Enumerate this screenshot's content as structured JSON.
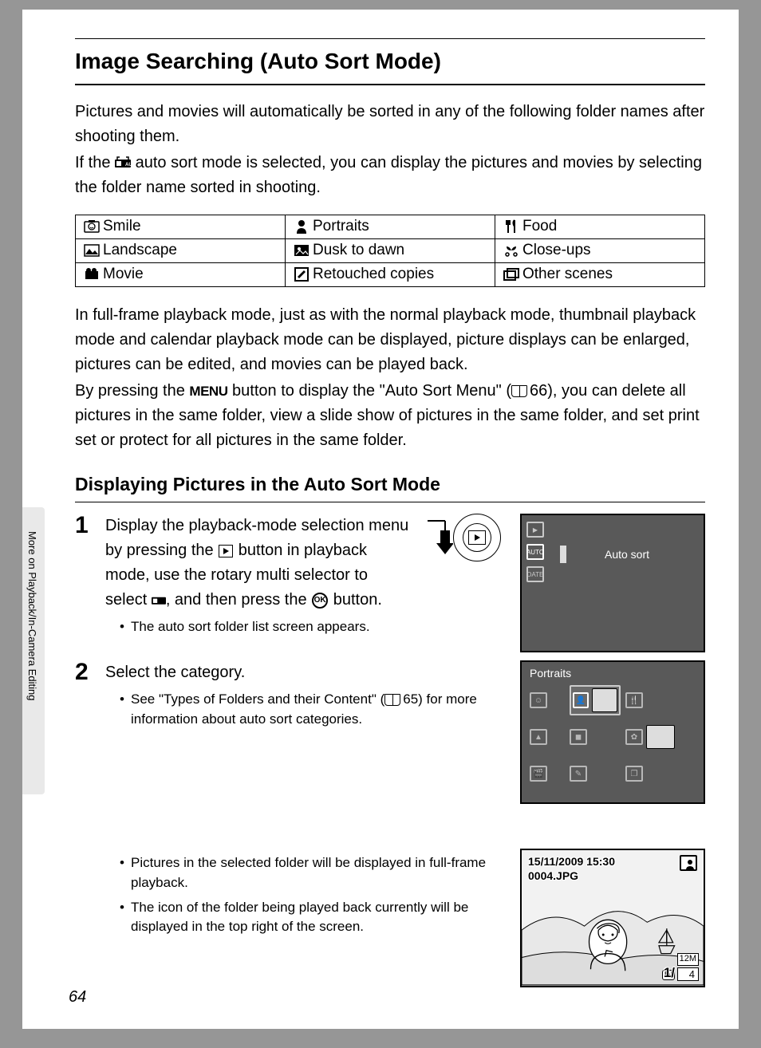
{
  "title": "Image Searching (Auto Sort Mode)",
  "intro1": "Pictures and movies will automatically be sorted in any of the following folder names after shooting them.",
  "intro2a": "If the ",
  "intro2b": " auto sort mode is selected, you can display the pictures and movies by selecting the folder name sorted in shooting.",
  "table": {
    "r1c1": "Smile",
    "r1c2": "Portraits",
    "r1c3": "Food",
    "r2c1": "Landscape",
    "r2c2": "Dusk to dawn",
    "r2c3": "Close-ups",
    "r3c1": "Movie",
    "r3c2": "Retouched copies",
    "r3c3": "Other scenes"
  },
  "mid1": "In full-frame playback mode, just as with the normal playback mode, thumbnail playback mode and calendar playback mode can be displayed, picture displays can be enlarged, pictures can be edited, and movies can be played back.",
  "mid2a": "By pressing the ",
  "menu": "MENU",
  "mid2b": " button to display the \"Auto Sort Menu\" (",
  "ref66": "66",
  "mid2c": "), you can delete all pictures in the same folder, view a slide show of pictures in the same folder, and set print set or protect for all pictures in the same folder.",
  "h2": "Displaying Pictures in the Auto Sort Mode",
  "step1": {
    "n": "1",
    "p1a": "Display the playback-mode selection menu by pressing the ",
    "p1b": " button in playback mode, use the rotary multi selector to select ",
    "p1c": ", and then press the ",
    "ok": "OK",
    "p1d": " button.",
    "b1": "The auto sort folder list screen appears.",
    "lcd_label": "Auto sort"
  },
  "step2": {
    "n": "2",
    "p": "Select the category.",
    "b1a": "See \"Types of Folders and their Content\" (",
    "ref65": "65",
    "b1b": ") for more information about auto sort categories.",
    "b2": "Pictures in the selected folder will be displayed in full-frame playback.",
    "b3": "The icon of the folder being played back currently will be displayed in the top right of the screen.",
    "lcd_title": "Portraits",
    "lcd3": {
      "date": "15/11/2009 15:30",
      "fname": "0004.JPG",
      "counter": "1/",
      "res1": "12M",
      "res2": "4",
      "in": "IN"
    }
  },
  "sidetab": "More on Playback/In-Camera Editing",
  "pagenum": "64"
}
